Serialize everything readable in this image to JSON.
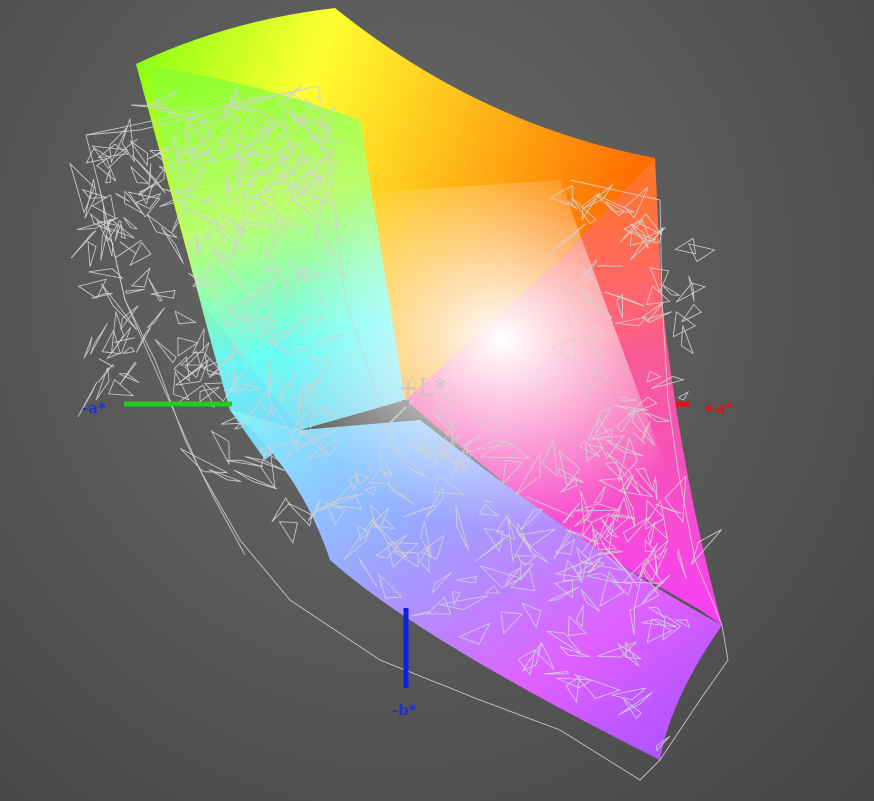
{
  "axes": {
    "neg_a": {
      "label": "-a*",
      "color": "#1a2fd6",
      "line_color": "#22cc22"
    },
    "pos_a": {
      "label": "+a*",
      "color": "#e01010",
      "line_color": "#ee1111"
    },
    "neg_b": {
      "label": "-b*",
      "color": "#1a2fd6",
      "line_color": "#1020e0"
    },
    "pos_l": {
      "label": "+L*",
      "color": "#bfbfbf",
      "line_color": "#a8a8a8"
    }
  },
  "colors": {
    "yellow": "#ffff30",
    "green": "#80ff10",
    "orange": "#ff6a00",
    "cyan": "#60ffff",
    "blue": "#7070ff",
    "magenta": "#ff40ff",
    "violet": "#a050ff",
    "white": "#ffffff",
    "wireframe": "#d2d2d2"
  }
}
